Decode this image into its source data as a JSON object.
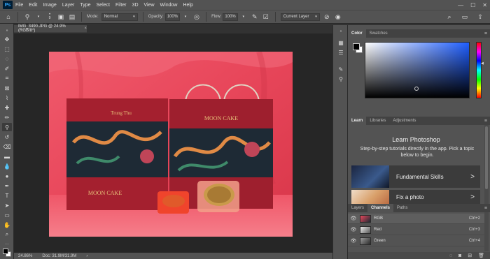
{
  "app": {
    "logo": "Ps"
  },
  "menu": [
    "File",
    "Edit",
    "Image",
    "Layer",
    "Type",
    "Select",
    "Filter",
    "3D",
    "View",
    "Window",
    "Help"
  ],
  "window_controls": {
    "minimize": "—",
    "maximize": "☐",
    "close": "✕"
  },
  "options_bar": {
    "brush_size": "9",
    "mode_label": "Mode:",
    "mode_value": "Normal",
    "opacity_label": "Opacity:",
    "opacity_value": "100%",
    "flow_label": "Flow:",
    "flow_value": "100%",
    "sample_value": "Current Layer"
  },
  "document": {
    "tab_title": "IMG_3490.JPG @ 24.9% (RGB/8*)",
    "close": "×",
    "zoom": "24.86%",
    "doc_info": "Doc: 31.9M/31.9M"
  },
  "color_panel": {
    "tabs": [
      "Color",
      "Swatches"
    ],
    "foreground": "#000000",
    "background": "#ffffff"
  },
  "learn_panel": {
    "tabs": [
      "Learn",
      "Libraries",
      "Adjustments"
    ],
    "title": "Learn Photoshop",
    "description": "Step-by-step tutorials directly in the app. Pick a topic below to begin.",
    "cards": [
      {
        "label": "Fundamental Skills",
        "arrow": ">"
      },
      {
        "label": "Fix a photo",
        "arrow": ">"
      }
    ]
  },
  "layers_panel": {
    "tabs": [
      "Layers",
      "Channels",
      "Paths"
    ],
    "channels": [
      {
        "name": "RGB",
        "shortcut": "Ctrl+2"
      },
      {
        "name": "Red",
        "shortcut": "Ctrl+3"
      },
      {
        "name": "Green",
        "shortcut": "Ctrl+4"
      }
    ]
  },
  "photo": {
    "box_brand": "Trung Thu",
    "bag_title": "MOON CAKE",
    "box_title": "MOON CAKE"
  }
}
